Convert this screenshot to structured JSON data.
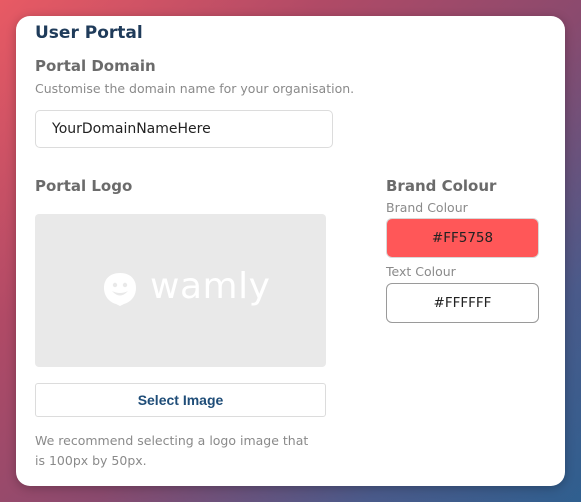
{
  "header": {
    "title": "User Portal"
  },
  "domain": {
    "section_title": "Portal Domain",
    "help": "Customise the domain name for your organisation.",
    "value": "YourDomainNameHere"
  },
  "logo": {
    "section_title": "Portal Logo",
    "wordmark": "wamly",
    "select_label": "Select Image",
    "recommend_line1": "We recommend selecting a logo image that",
    "recommend_line2": "is 100px by 50px."
  },
  "brand": {
    "section_title": "Brand Colour",
    "brand_label": "Brand Colour",
    "brand_value": "#FF5758",
    "text_label": "Text Colour",
    "text_value": "#FFFFFF"
  },
  "colors": {
    "brand_swatch": "#FF5758",
    "text_swatch": "#FFFFFF",
    "title_color": "#1f3b5a",
    "button_text": "#1f4d78"
  },
  "icons": {
    "logo_mark": "wamly-chat-smile-icon"
  }
}
